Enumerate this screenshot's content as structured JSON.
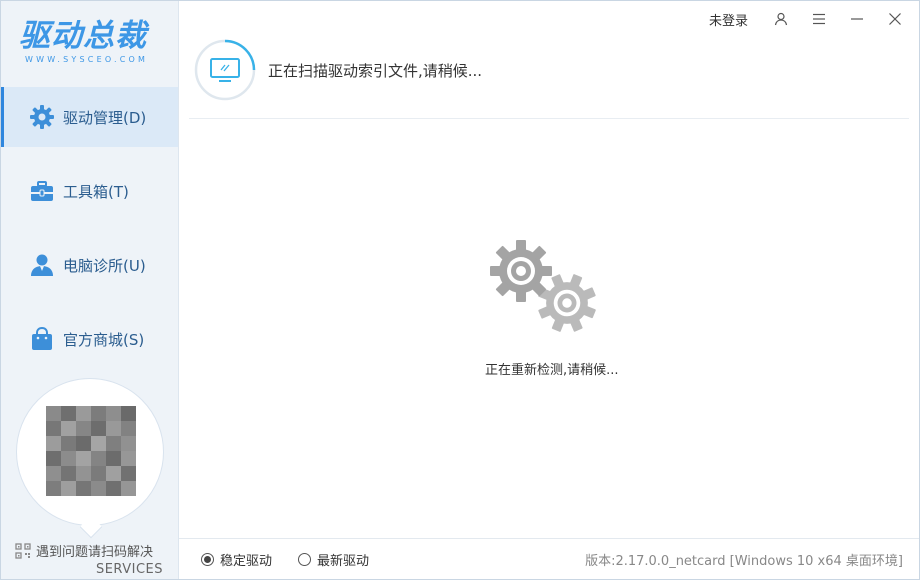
{
  "app": {
    "logo_text": "驱动总裁",
    "logo_sub": "WWW.SYSCEO.COM",
    "accent_color": "#3d97e6"
  },
  "topbar": {
    "login_label": "未登录",
    "icons": [
      "user-icon",
      "menu-icon",
      "minimize-icon",
      "close-icon"
    ]
  },
  "sidebar": {
    "items": [
      {
        "label": "驱动管理(D)",
        "icon": "gear-icon",
        "active": true
      },
      {
        "label": "工具箱(T)",
        "icon": "toolbox-icon",
        "active": false
      },
      {
        "label": "电脑诊所(U)",
        "icon": "doctor-icon",
        "active": false
      },
      {
        "label": "官方商城(S)",
        "icon": "shopping-bag-icon",
        "active": false
      }
    ],
    "help_text": "遇到问题请扫码解决",
    "help_services": "SERVICES"
  },
  "header": {
    "status_text": "正在扫描驱动索引文件,请稍候..."
  },
  "main": {
    "status_text": "正在重新检测,请稍候..."
  },
  "footer": {
    "options": [
      {
        "label": "稳定驱动",
        "checked": true
      },
      {
        "label": "最新驱动",
        "checked": false
      }
    ],
    "version_text": "版本:2.17.0.0_netcard [Windows 10 x64 桌面环境]"
  }
}
